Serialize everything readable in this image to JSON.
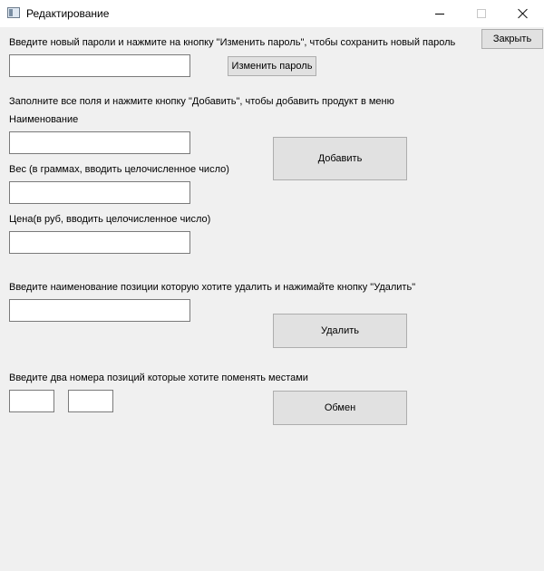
{
  "window": {
    "title": "Редактирование",
    "minimize_icon": "minimize-icon",
    "maximize_icon": "maximize-icon",
    "close_icon": "close-icon"
  },
  "password": {
    "instruction": "Введите новый пароли и нажмите на кнопку \"Изменить пароль\", чтобы сохранить новый пароль",
    "input_value": "",
    "change_button": "Изменить пароль",
    "close_button": "Закрыть"
  },
  "add_product": {
    "instruction": "Заполните все поля и нажмите кнопку \"Добавить\", чтобы добавить продукт в меню",
    "name_label": "Наименование",
    "name_value": "",
    "weight_label": "Вес (в граммах, вводить целочисленное число)",
    "weight_value": "",
    "price_label": "Цена(в руб, вводить целочисленное число)",
    "price_value": "",
    "add_button": "Добавить"
  },
  "delete_item": {
    "instruction": "Введите наименование позиции которую хотите удалить и нажимайте кнопку \"Удалить\"",
    "input_value": "",
    "delete_button": "Удалить"
  },
  "swap": {
    "instruction": "Введите два номера позиций которые хотите поменять местами",
    "first_value": "",
    "second_value": "",
    "swap_button": "Обмен"
  }
}
